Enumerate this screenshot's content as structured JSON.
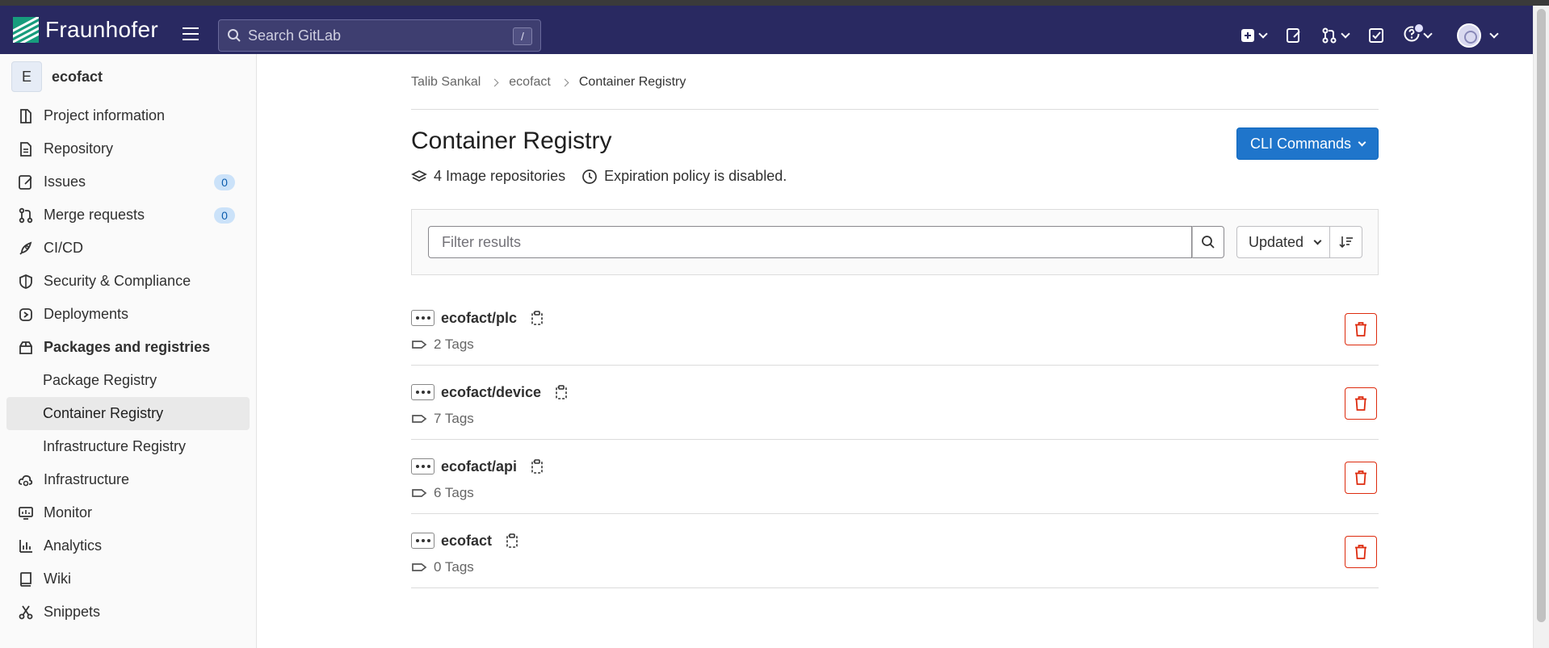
{
  "brand": {
    "name": "Fraunhofer"
  },
  "search": {
    "placeholder": "Search GitLab",
    "shortcut": "/"
  },
  "project": {
    "avatar_letter": "E",
    "name": "ecofact"
  },
  "sidebar": {
    "items": [
      {
        "label": "Project information",
        "icon": "info-icon"
      },
      {
        "label": "Repository",
        "icon": "doc-icon"
      },
      {
        "label": "Issues",
        "icon": "issues-icon",
        "badge": "0"
      },
      {
        "label": "Merge requests",
        "icon": "merge-request-icon",
        "badge": "0"
      },
      {
        "label": "CI/CD",
        "icon": "rocket-icon"
      },
      {
        "label": "Security & Compliance",
        "icon": "shield-icon"
      },
      {
        "label": "Deployments",
        "icon": "deployments-icon"
      },
      {
        "label": "Packages and registries",
        "icon": "package-icon"
      }
    ],
    "sub_items": [
      {
        "label": "Package Registry"
      },
      {
        "label": "Container Registry"
      },
      {
        "label": "Infrastructure Registry"
      }
    ],
    "bottom_items": [
      {
        "label": "Infrastructure",
        "icon": "cloud-gear-icon"
      },
      {
        "label": "Monitor",
        "icon": "monitor-icon"
      },
      {
        "label": "Analytics",
        "icon": "chart-icon"
      },
      {
        "label": "Wiki",
        "icon": "book-icon"
      },
      {
        "label": "Snippets",
        "icon": "scissors-icon"
      }
    ]
  },
  "breadcrumb": [
    "Talib Sankal",
    "ecofact",
    "Container Registry"
  ],
  "page": {
    "title": "Container Registry",
    "cli_button": "CLI Commands",
    "image_count": "4 Image repositories",
    "expiration": "Expiration policy is disabled."
  },
  "filter": {
    "placeholder": "Filter results",
    "sort_label": "Updated"
  },
  "repositories": [
    {
      "name": "ecofact/plc",
      "tags": "2 Tags"
    },
    {
      "name": "ecofact/device",
      "tags": "7 Tags"
    },
    {
      "name": "ecofact/api",
      "tags": "6 Tags"
    },
    {
      "name": "ecofact",
      "tags": "0 Tags"
    }
  ],
  "colors": {
    "navbar": "#292961",
    "primary": "#1f75cb",
    "danger": "#dd2b0e",
    "logo_green": "#179c7d"
  }
}
